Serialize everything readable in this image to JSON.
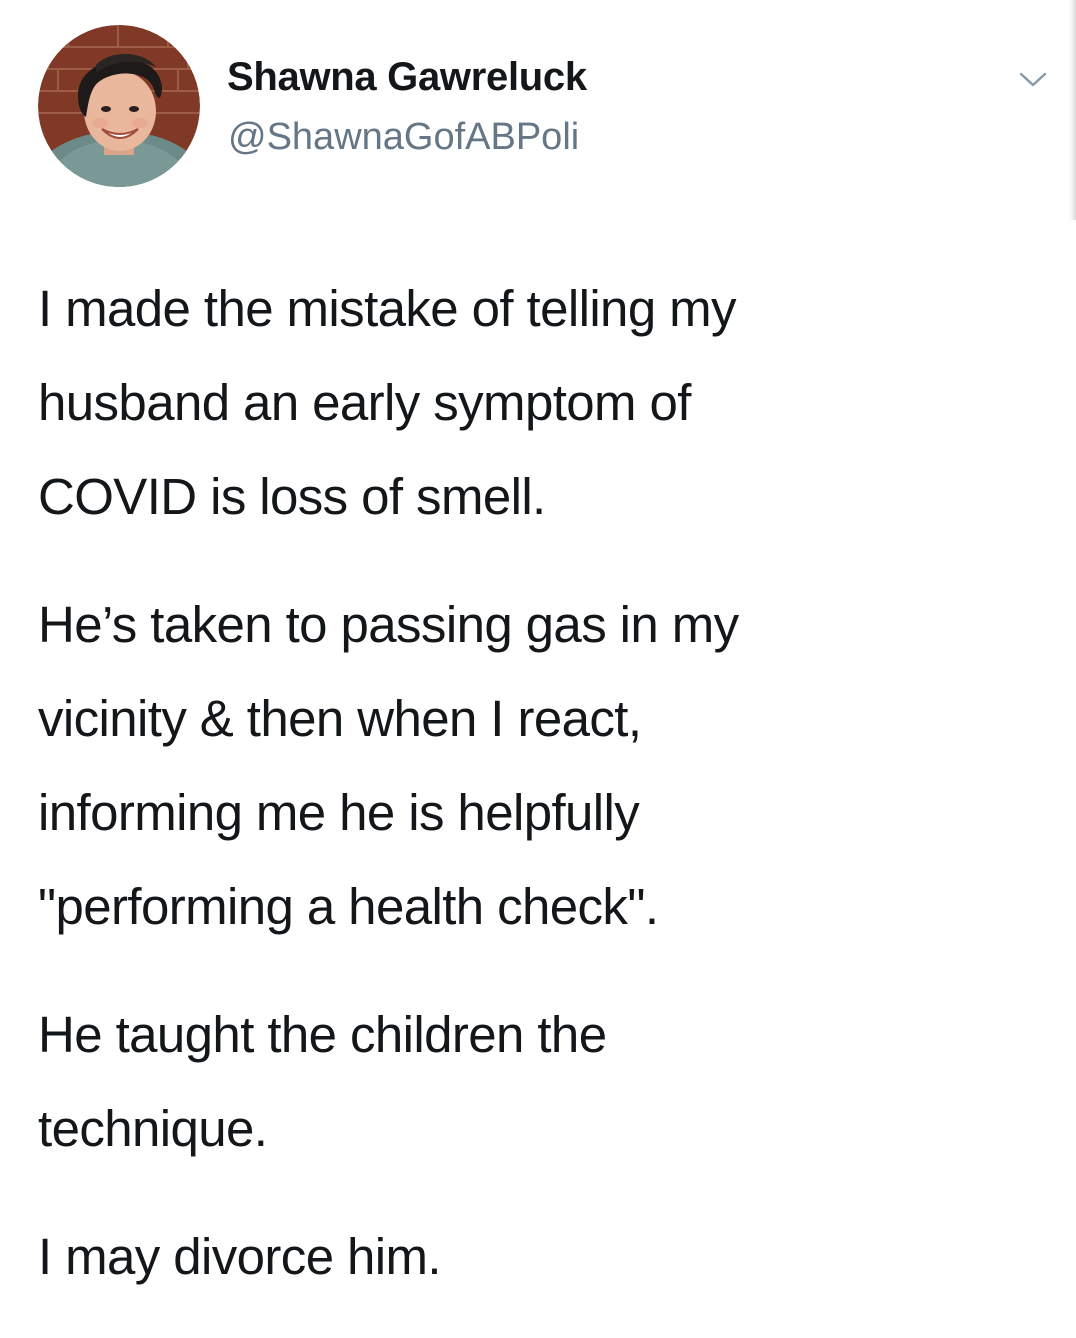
{
  "tweet": {
    "author": {
      "display_name": "Shawna Gawreluck",
      "handle": "@ShawnaGofABPoli",
      "avatar_icon": "profile-photo"
    },
    "menu_icon": "chevron-down-icon",
    "paragraphs": [
      {
        "lines": [
          "I made the mistake of telling my",
          "husband an early symptom of",
          "COVID is loss of smell."
        ]
      },
      {
        "lines": [
          "He’s taken to passing gas in my",
          "vicinity & then when I react,",
          "informing me he is helpfully",
          "\"performing a health check\"."
        ]
      },
      {
        "lines": [
          "He taught the children the",
          "technique."
        ]
      },
      {
        "lines": [
          "I may divorce him."
        ]
      }
    ]
  },
  "colors": {
    "text": "#14171a",
    "secondary_text": "#657786",
    "chevron": "#8899a6",
    "background": "#ffffff"
  }
}
